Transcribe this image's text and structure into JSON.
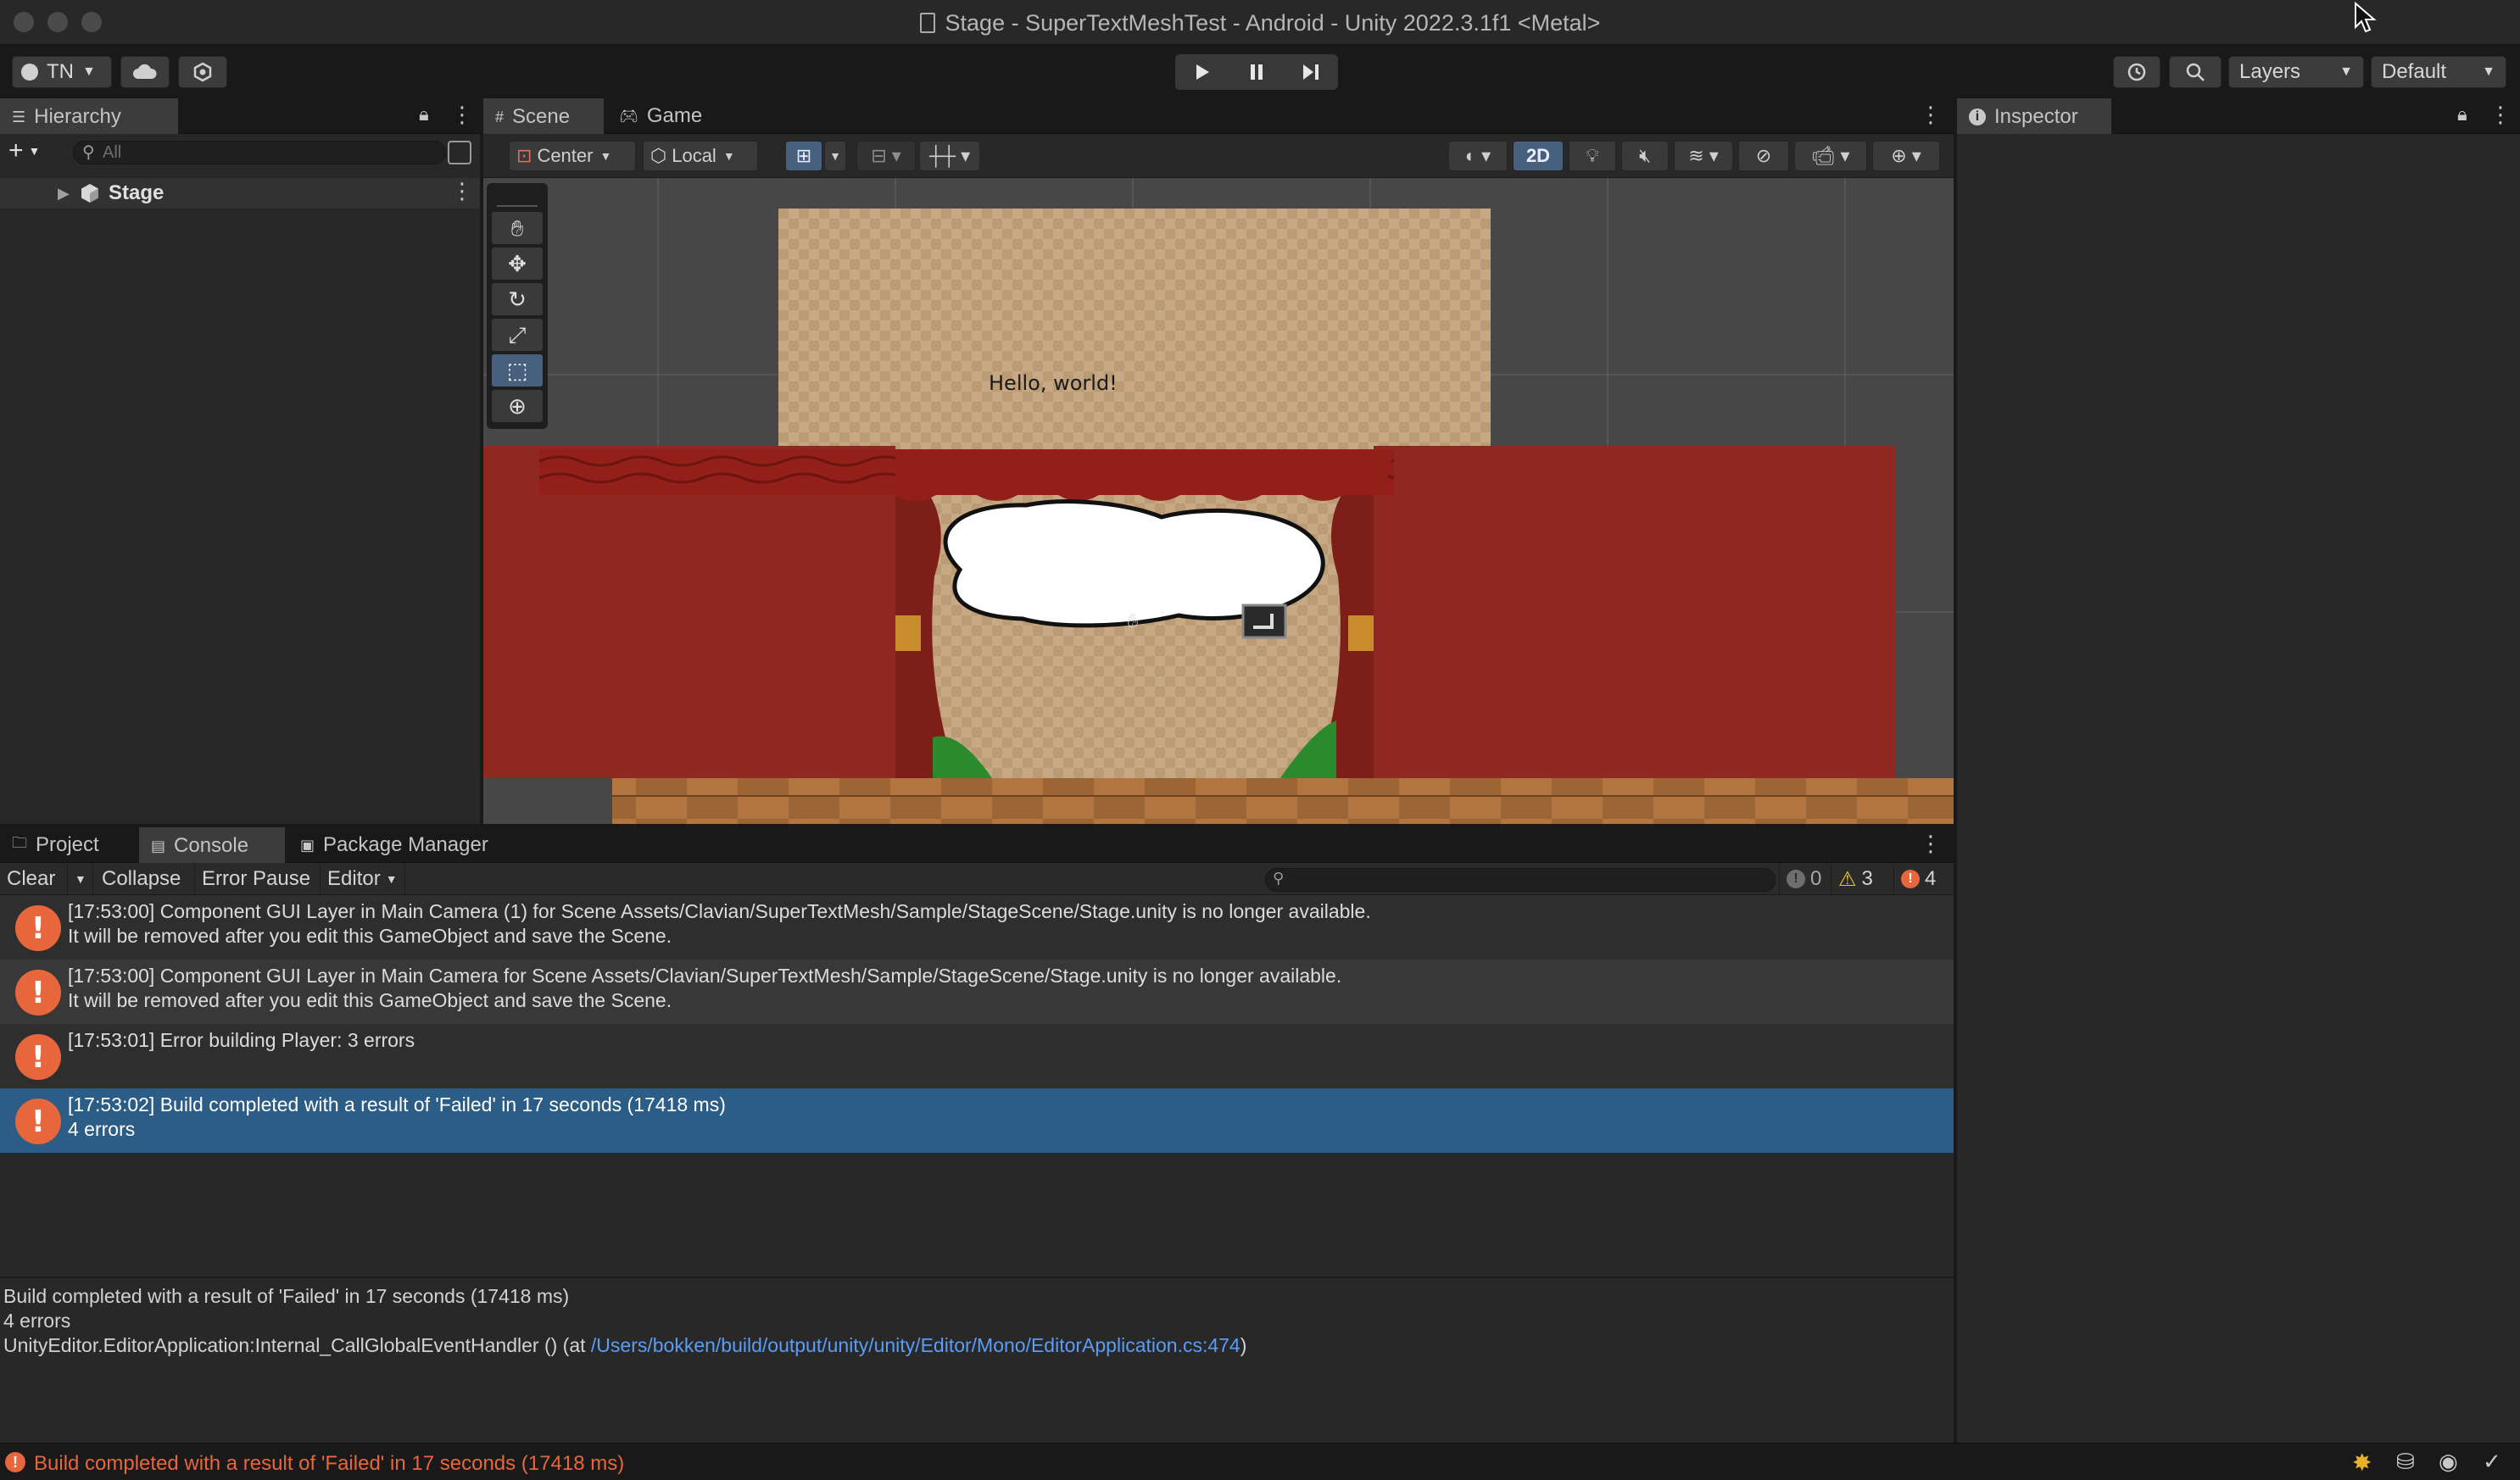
{
  "window": {
    "title": "Stage - SuperTextMeshTest - Android - Unity 2022.3.1f1 <Metal>"
  },
  "toolbar": {
    "account_label": "TN",
    "layers_label": "Layers",
    "layout_label": "Default"
  },
  "hierarchy": {
    "tab": "Hierarchy",
    "search_placeholder": "All",
    "root_label": "Stage"
  },
  "scene": {
    "tabs": [
      "Scene",
      "Game"
    ],
    "pivot_label": "Center",
    "space_label": "Local",
    "mode_2d_label": "2D",
    "speech_text": "Hello, world!"
  },
  "inspector": {
    "tab": "Inspector"
  },
  "bottom_tabs": [
    "Project",
    "Console",
    "Package Manager"
  ],
  "console": {
    "clear_label": "Clear",
    "collapse_label": "Collapse",
    "error_pause_label": "Error Pause",
    "editor_label": "Editor",
    "counts": {
      "info": "0",
      "warnings": "3",
      "errors": "4"
    },
    "entries": [
      {
        "line1": "[17:53:00] Component GUI Layer in Main Camera (1) for Scene Assets/Clavian/SuperTextMesh/Sample/StageScene/Stage.unity is no longer available.",
        "line2": "It will be removed after you edit this GameObject and save the Scene."
      },
      {
        "line1": "[17:53:00] Component GUI Layer in Main Camera for Scene Assets/Clavian/SuperTextMesh/Sample/StageScene/Stage.unity is no longer available.",
        "line2": "It will be removed after you edit this GameObject and save the Scene."
      },
      {
        "line1": "[17:53:01] Error building Player: 3 errors",
        "line2": ""
      },
      {
        "line1": "[17:53:02] Build completed with a result of 'Failed' in 17 seconds (17418 ms)",
        "line2": "4 errors"
      }
    ],
    "detail": {
      "line1": "Build completed with a result of 'Failed' in 17 seconds (17418 ms)",
      "line2": "4 errors",
      "line3_prefix": "UnityEditor.EditorApplication:Internal_CallGlobalEventHandler () (at ",
      "line3_link": "/Users/bokken/build/output/unity/unity/Editor/Mono/EditorApplication.cs:474",
      "line3_suffix": ")"
    }
  },
  "status_bar": {
    "message": "Build completed with a result of 'Failed' in 17 seconds (17418 ms)"
  },
  "colors": {
    "error": "#e8663c",
    "selection": "#2c5d87",
    "link": "#5b9cf5",
    "curtain": "#8e2820"
  }
}
